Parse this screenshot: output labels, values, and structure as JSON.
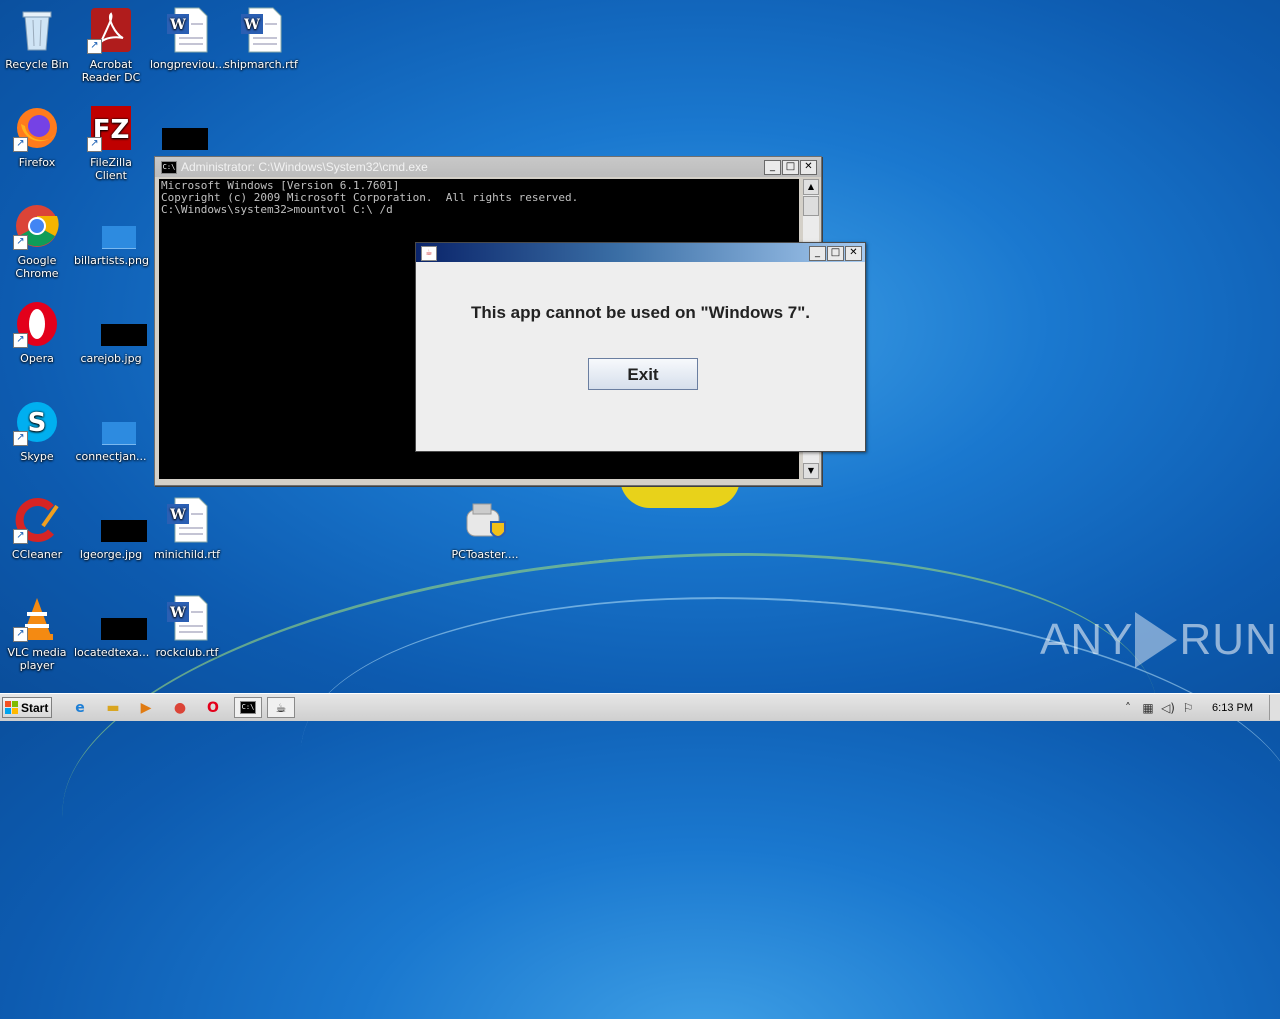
{
  "desktop": {
    "icons": [
      {
        "label": "Recycle Bin"
      },
      {
        "label": "Acrobat Reader DC"
      },
      {
        "label": "longpreviou..."
      },
      {
        "label": "shipmarch.rtf"
      },
      {
        "label": "Firefox"
      },
      {
        "label": "FileZilla Client"
      },
      {
        "label": "Google Chrome"
      },
      {
        "label": "billartists.png"
      },
      {
        "label": "Opera"
      },
      {
        "label": "carejob.jpg"
      },
      {
        "label": "Skype"
      },
      {
        "label": "connectjan..."
      },
      {
        "label": "CCleaner"
      },
      {
        "label": "lgeorge.jpg"
      },
      {
        "label": "minichild.rtf"
      },
      {
        "label": "PCToaster...."
      },
      {
        "label": "VLC media player"
      },
      {
        "label": "locatedtexa..."
      },
      {
        "label": "rockclub.rtf"
      }
    ]
  },
  "cmd_window": {
    "title": "Administrator: C:\\Windows\\System32\\cmd.exe",
    "icon_text": "C:\\",
    "lines": [
      "Microsoft Windows [Version 6.1.7601]",
      "Copyright (c) 2009 Microsoft Corporation.  All rights reserved.",
      "",
      "C:\\Windows\\system32>mountvol C:\\ /d"
    ]
  },
  "dialog": {
    "message": "This app cannot be used on \"Windows 7\".",
    "exit_label": "Exit"
  },
  "window_buttons": {
    "minimize": "_",
    "maximize": "□",
    "close": "✕"
  },
  "taskbar": {
    "start_label": "Start",
    "clock": "6:13 PM"
  },
  "watermark": {
    "left": "ANY",
    "right": "RUN"
  },
  "colors": {
    "desktop": "#1a78cf",
    "dialog_title_start": "#0a246a",
    "dialog_title_end": "#a6caf0",
    "console_bg": "#000000",
    "console_text": "#c0c0c0"
  }
}
